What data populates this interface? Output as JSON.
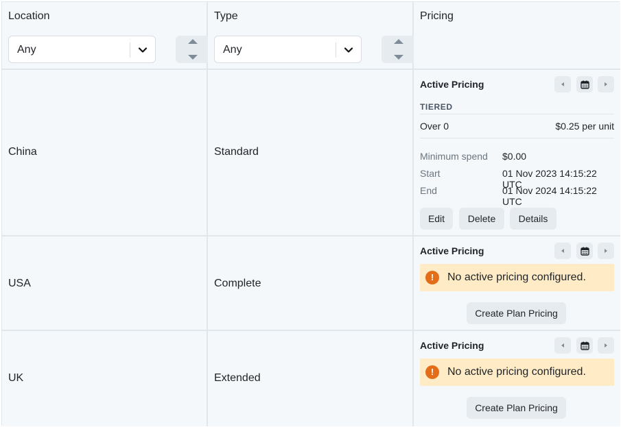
{
  "columns": {
    "location": {
      "title": "Location",
      "filter_value": "Any"
    },
    "type": {
      "title": "Type",
      "filter_value": "Any"
    },
    "pricing": {
      "title": "Pricing"
    }
  },
  "rows": [
    {
      "location": "China",
      "type": "Standard",
      "pricing": {
        "title": "Active Pricing",
        "model": "TIERED",
        "tier_label": "Over 0",
        "tier_price": "$0.25 per unit",
        "minimum_spend_label": "Minimum spend",
        "minimum_spend_value": "$0.00",
        "start_label": "Start",
        "start_value": "01 Nov 2023 14:15:22 UTC",
        "end_label": "End",
        "end_value": "01 Nov 2024 14:15:22 UTC",
        "actions": {
          "edit": "Edit",
          "delete": "Delete",
          "details": "Details"
        }
      }
    },
    {
      "location": "USA",
      "type": "Complete",
      "pricing": {
        "title": "Active Pricing",
        "warning": "No active pricing configured.",
        "create_label": "Create Plan Pricing"
      }
    },
    {
      "location": "UK",
      "type": "Extended",
      "pricing": {
        "title": "Active Pricing",
        "warning": "No active pricing configured.",
        "create_label": "Create Plan Pricing"
      }
    }
  ],
  "icons": {
    "prev": "triangle-left-icon",
    "calendar": "calendar-icon",
    "next": "triangle-right-icon",
    "warning": "exclamation-circle-icon",
    "sort": "sort-up-down-icon",
    "chevron": "chevron-down-icon"
  },
  "colors": {
    "background": "#f4f8fb",
    "border": "#dfe6ec",
    "button": "#e6ebf0",
    "warning_bg": "#ffecc6",
    "warning_icon": "#e46d1a"
  }
}
